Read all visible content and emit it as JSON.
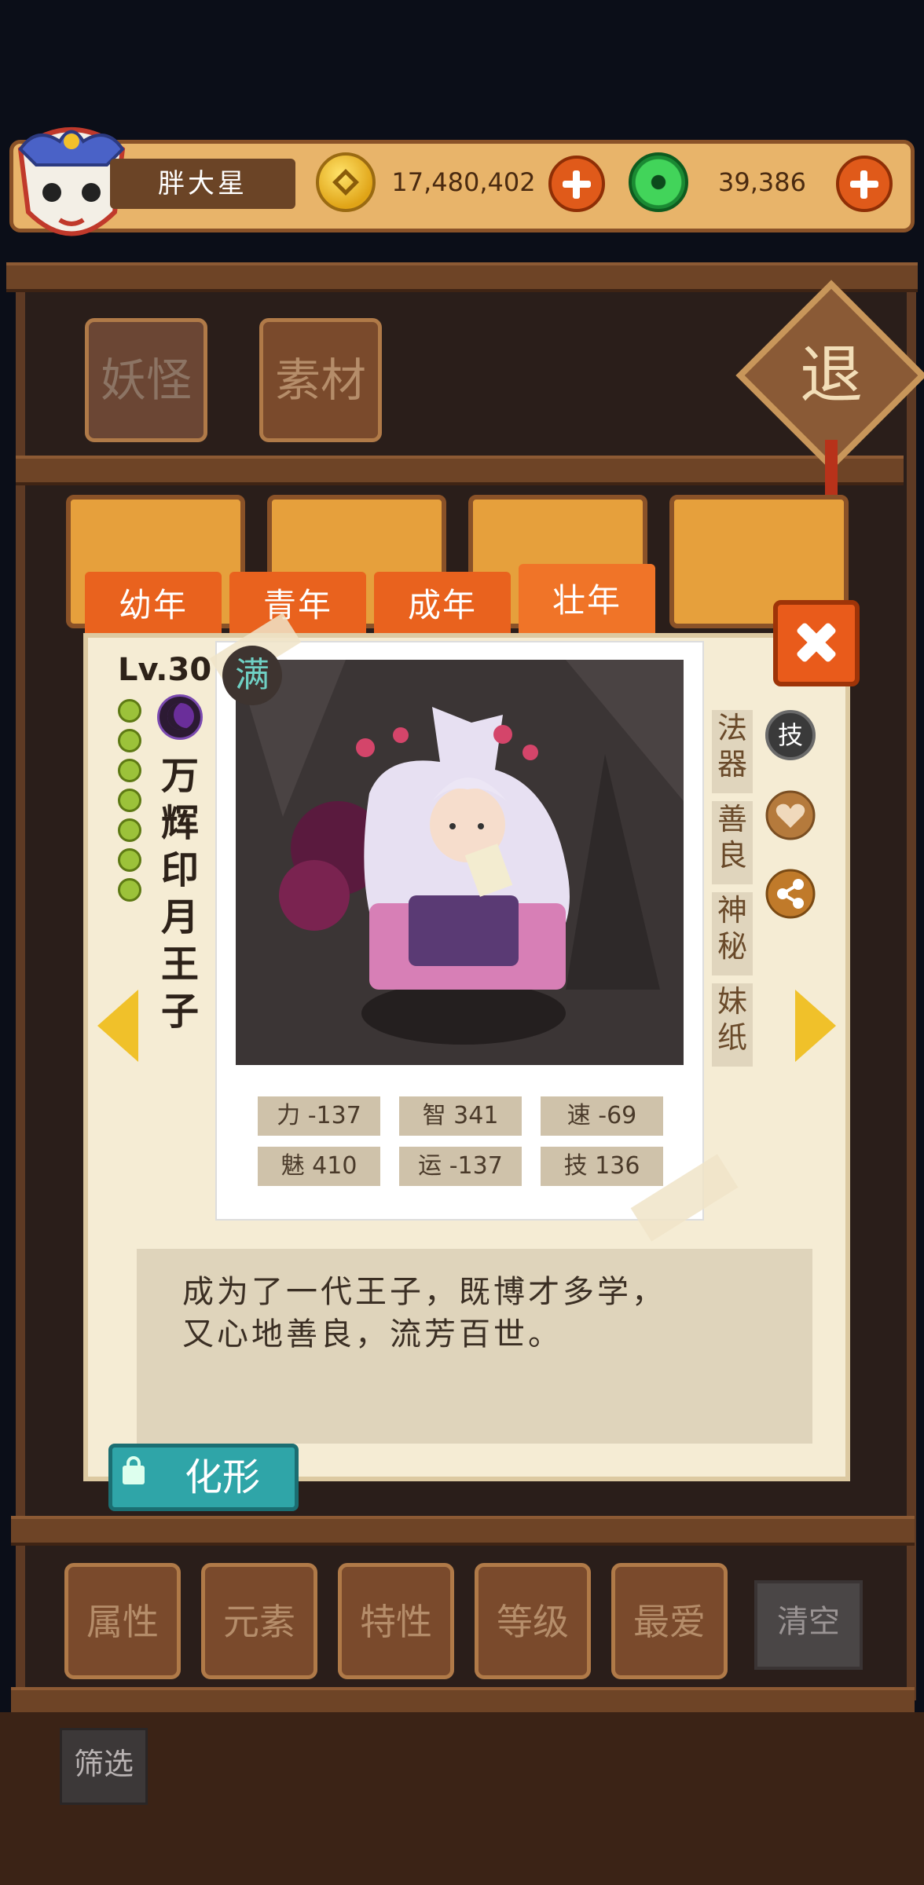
{
  "header": {
    "player_name": "胖大星",
    "coins": "17,480,402",
    "gems": "39,386",
    "coin_icon": "gold-coin-icon",
    "gem_icon": "jade-gem-icon"
  },
  "nav": {
    "tabs": [
      "妖怪",
      "素材"
    ],
    "retreat_label": "退"
  },
  "filters": {
    "buttons": [
      "属性",
      "元素",
      "特性",
      "等级",
      "最爱"
    ],
    "clear_label": "清空",
    "sift_label": "筛选"
  },
  "modal": {
    "age_tabs": [
      "幼年",
      "青年",
      "成年",
      "壮年"
    ],
    "active_age_tab": "壮年",
    "level": "Lv.30",
    "max_badge": "满",
    "name": "万辉印月王子",
    "stats": [
      {
        "label": "力",
        "value": "-137"
      },
      {
        "label": "智",
        "value": "341"
      },
      {
        "label": "速",
        "value": "-69"
      },
      {
        "label": "魅",
        "value": "410"
      },
      {
        "label": "运",
        "value": "-137"
      },
      {
        "label": "技",
        "value": "136"
      }
    ],
    "tags": [
      "法器",
      "善良",
      "神秘",
      "妹纸"
    ],
    "skill_icon_label": "技",
    "description_line1": "成为了一代王子，既博才多学，",
    "description_line2": "又心地善良，流芳百世。",
    "transform_label": "化形",
    "colors": {
      "tab": "#e9621e",
      "accent_teal": "#2fa5a8",
      "arrow": "#f0c12a"
    }
  }
}
